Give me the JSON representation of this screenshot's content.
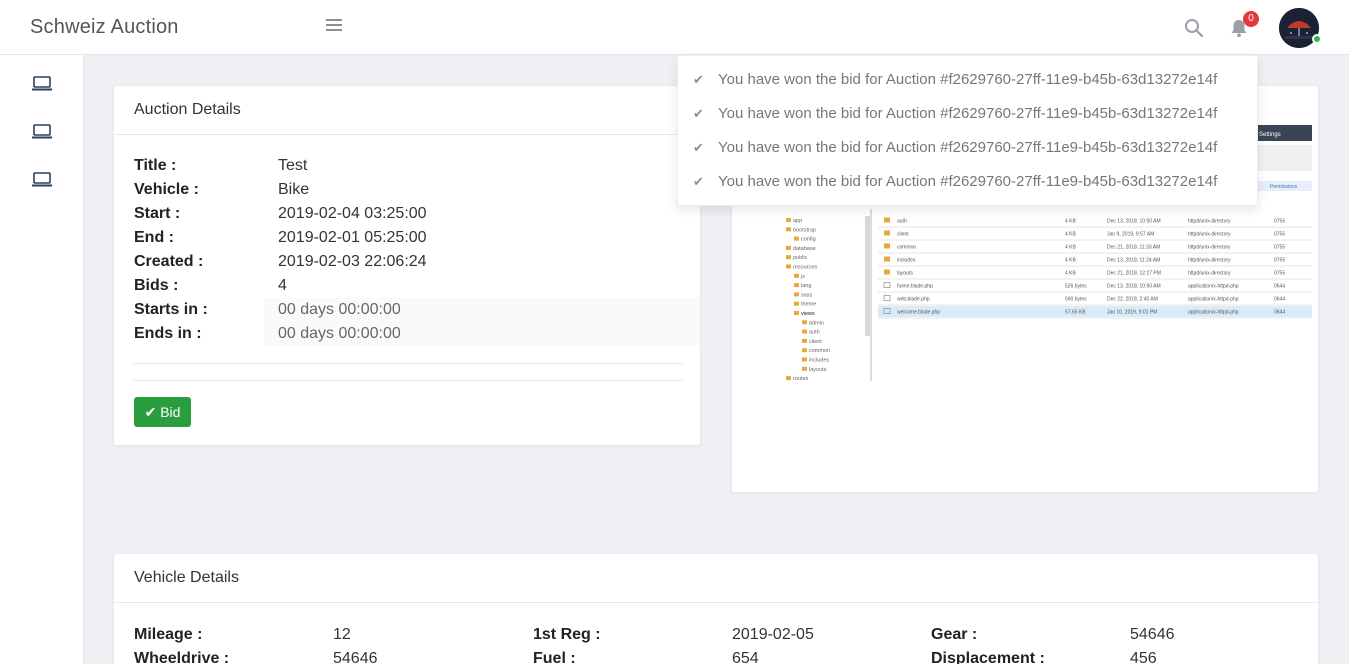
{
  "header": {
    "brand": "Schweiz Auction",
    "notification_count": "0"
  },
  "auction": {
    "title": "Auction Details",
    "fields": [
      {
        "label": "Title :",
        "value": "Test"
      },
      {
        "label": "Vehicle :",
        "value": "Bike"
      },
      {
        "label": "Start :",
        "value": "2019-02-04 03:25:00"
      },
      {
        "label": "End :",
        "value": "2019-02-01 05:25:00"
      },
      {
        "label": "Created :",
        "value": "2019-02-03 22:06:24"
      },
      {
        "label": "Bids :",
        "value": "4"
      },
      {
        "label": "Starts in :",
        "value": "00 days 00:00:00"
      },
      {
        "label": "Ends in :",
        "value": "00 days 00:00:00"
      }
    ],
    "bid_label": "Bid"
  },
  "notifications": [
    "You have won the bid for Auction #f2629760-27ff-11e9-b45b-63d13272e14f",
    "You have won the bid for Auction #f2629760-27ff-11e9-b45b-63d13272e14f",
    "You have won the bid for Auction #f2629760-27ff-11e9-b45b-63d13272e14f",
    "You have won the bid for Auction #f2629760-27ff-11e9-b45b-63d13272e14f"
  ],
  "vehicle": {
    "title": "Vehicle Details",
    "fields": [
      {
        "label": "Mileage :",
        "value": "12"
      },
      {
        "label": "1st Reg :",
        "value": "2019-02-05"
      },
      {
        "label": "Gear :",
        "value": "54646"
      },
      {
        "label": "Wheeldrive :",
        "value": "54646"
      },
      {
        "label": "Fuel :",
        "value": "654"
      },
      {
        "label": "Displacement :",
        "value": "456"
      }
    ]
  },
  "screenshot": {
    "toolbar_button": "Settings",
    "column_header": "Permissions",
    "tree": [
      "app",
      "bootstrap",
      "config",
      "database",
      "public",
      "resources",
      "js",
      "lang",
      "sass",
      "theme",
      "views",
      "admin",
      "auth",
      "client",
      "common",
      "includes",
      "layouts",
      "routes"
    ],
    "files": [
      {
        "name": "auth",
        "size": "4 KB",
        "date": "Dec 13, 2018, 10:50 AM",
        "type": "httpd/unix-directory",
        "perm": "0755"
      },
      {
        "name": "client",
        "size": "4 KB",
        "date": "Jan 9, 2019, 9:57 AM",
        "type": "httpd/unix-directory",
        "perm": "0755"
      },
      {
        "name": "common",
        "size": "4 KB",
        "date": "Dec 21, 2018, 11:33 AM",
        "type": "httpd/unix-directory",
        "perm": "0755"
      },
      {
        "name": "includes",
        "size": "4 KB",
        "date": "Dec 13, 2018, 11:24 AM",
        "type": "httpd/unix-directory",
        "perm": "0755"
      },
      {
        "name": "layouts",
        "size": "4 KB",
        "date": "Dec 21, 2018, 12:27 PM",
        "type": "httpd/unix-directory",
        "perm": "0755"
      },
      {
        "name": "home.blade.php",
        "size": "526 bytes",
        "date": "Dec 13, 2018, 10:50 AM",
        "type": "application/x-httpd-php",
        "perm": "0644"
      },
      {
        "name": "web.blade.php",
        "size": "590 bytes",
        "date": "Dec 22, 2018, 2:40 AM",
        "type": "application/x-httpd-php",
        "perm": "0644"
      },
      {
        "name": "welcome.blade.php",
        "size": "57.65 KB",
        "date": "Jan 10, 2019, 9:01 PM",
        "type": "application/x-httpd-php",
        "perm": "0644"
      }
    ]
  },
  "colors": {
    "accent_green": "#2a9d3e",
    "badge_red": "#e23a3a",
    "page_bg": "#eef0f4"
  }
}
